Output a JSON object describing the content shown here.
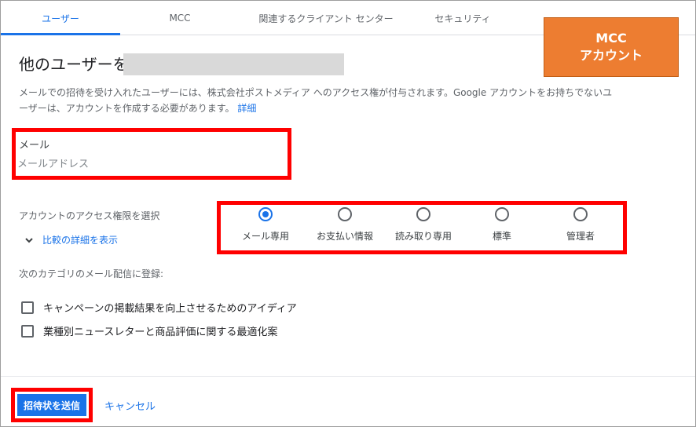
{
  "tabs": [
    {
      "label": "ユーザー",
      "active": true
    },
    {
      "label": "MCC",
      "active": false
    },
    {
      "label": "関連するクライアント センター",
      "active": false
    },
    {
      "label": "セキュリティ",
      "active": false
    }
  ],
  "badge": {
    "line1": "MCC",
    "line2": "アカウント",
    "color": "#ed7d31"
  },
  "header": {
    "title": "他のユーザーを"
  },
  "description": {
    "text": "メールでの招待を受け入れたユーザーには、株式会社ポストメディア へのアクセス権が付与されます。Google アカウントをお持ちでないユーザーは、アカウントを作成する必要があります。",
    "link": "詳細"
  },
  "email": {
    "label": "メール",
    "placeholder": "メールアドレス"
  },
  "access": {
    "label": "アカウントのアクセス権限を選択",
    "compare_link": "比較の詳細を表示",
    "options": [
      {
        "label": "メール専用",
        "checked": true
      },
      {
        "label": "お支払い情報",
        "checked": false
      },
      {
        "label": "読み取り専用",
        "checked": false
      },
      {
        "label": "標準",
        "checked": false
      },
      {
        "label": "管理者",
        "checked": false
      }
    ]
  },
  "categories": {
    "label": "次のカテゴリのメール配信に登録:",
    "items": [
      {
        "label": "キャンペーンの掲載結果を向上させるためのアイディア",
        "checked": false
      },
      {
        "label": "業種別ニュースレターと商品評価に関する最適化案",
        "checked": false
      }
    ]
  },
  "footer": {
    "send_label": "招待状を送信",
    "cancel_label": "キャンセル"
  },
  "colors": {
    "accent": "#1a73e8",
    "highlight": "#ff0000"
  }
}
